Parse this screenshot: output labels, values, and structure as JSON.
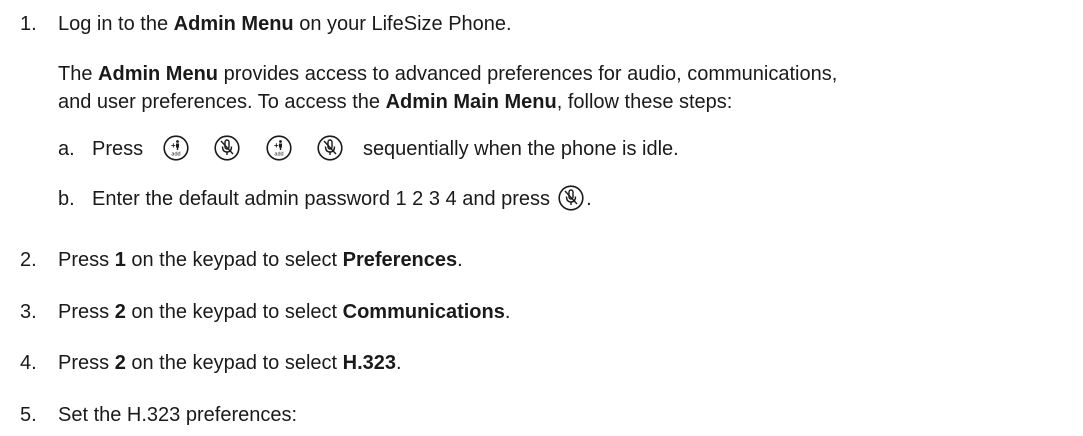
{
  "steps": [
    {
      "num": "1.",
      "pre": "Log in to the ",
      "bold": "Admin Menu",
      "post": " on your LifeSize Phone."
    },
    {
      "num": "2.",
      "pre": "Press ",
      "key": "1",
      "mid": " on the keypad to select ",
      "target": "Preferences",
      "post": "."
    },
    {
      "num": "3.",
      "pre": "Press ",
      "key": "2",
      "mid": " on the keypad to select ",
      "target": "Communications",
      "post": "."
    },
    {
      "num": "4.",
      "pre": "Press ",
      "key": "2",
      "mid": " on the keypad to select ",
      "target": "H.323",
      "post": "."
    },
    {
      "num": "5.",
      "text": "Set the H.323 preferences:"
    }
  ],
  "intro": {
    "line1_pre": "The ",
    "line1_bold": "Admin Menu",
    "line1_post": " provides access to advanced preferences for audio, communications,",
    "line2_pre": "and user preferences. To access the ",
    "line2_bold": "Admin Main Menu",
    "line2_post": ", follow these steps:"
  },
  "substeps": [
    {
      "letter": "a.",
      "pre": "Press",
      "post": "sequentially when the phone is idle.",
      "icons": [
        "add-icon",
        "mute-icon",
        "add-icon",
        "mute-icon"
      ]
    },
    {
      "letter": "b.",
      "pre": "Enter the default admin password 1 2 3 4 and press",
      "post": ".",
      "icons": [
        "mute-icon"
      ]
    }
  ],
  "add_icon_label": "add",
  "add_icon_symbol": "+"
}
